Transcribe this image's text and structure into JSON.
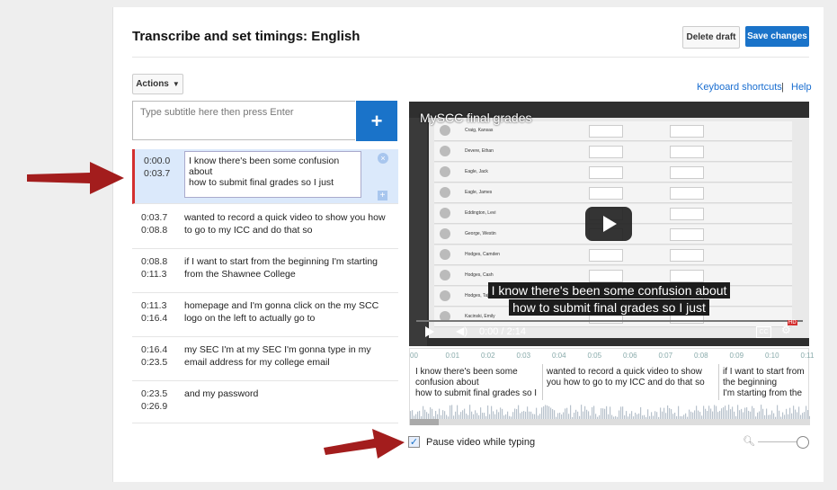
{
  "header": {
    "title": "Transcribe and set timings: English",
    "delete_label": "Delete draft",
    "save_label": "Save changes"
  },
  "toolbar": {
    "actions_label": "Actions",
    "keyboard_shortcuts": "Keyboard shortcuts",
    "separator": "|",
    "help": "Help"
  },
  "subtitle_input": {
    "placeholder": "Type subtitle here then press Enter",
    "add_icon": "plus-icon"
  },
  "captions": [
    {
      "start": "0:00.0",
      "end": "0:03.7",
      "text": "I know there's been some confusion about\nhow to submit final grades so I just",
      "selected": true
    },
    {
      "start": "0:03.7",
      "end": "0:08.8",
      "text": "wanted to record a quick video to show you how to go to my ICC and do that so"
    },
    {
      "start": "0:08.8",
      "end": "0:11.3",
      "text": "if I want to start from the beginning I'm starting from the Shawnee College"
    },
    {
      "start": "0:11.3",
      "end": "0:16.4",
      "text": "homepage and I'm gonna click on the my SCC logo on the left to actually go to"
    },
    {
      "start": "0:16.4",
      "end": "0:23.5",
      "text": "my SEC I'm at my SEC I'm gonna type in my email address for my college email"
    },
    {
      "start": "0:23.5",
      "end": "0:26.9",
      "text": "and my password"
    }
  ],
  "video": {
    "title": "MySCC final grades",
    "caption_line1": "I know there's been some confusion about",
    "caption_line2": "how to submit final grades so I just",
    "time": "0:00 / 2:14",
    "cc": "CC",
    "hd": "HD",
    "sheet_rows": [
      "Craig, Kansas",
      "Devere, Ethan",
      "Eagle, Jack",
      "Eagle, James",
      "Eddington, Levi",
      "George, Westin",
      "Hodges, Camden",
      "Hodges, Cash",
      "Hodges, Taj",
      "Kacinski, Emily"
    ]
  },
  "timeline": {
    "ticks": [
      "00",
      "0:01",
      "0:02",
      "0:03",
      "0:04",
      "0:05",
      "0:06",
      "0:07",
      "0:08",
      "0:09",
      "0:10",
      "0:11"
    ],
    "segments": [
      "I know there's been some confusion about\nhow to submit final grades so I",
      "wanted to record a quick video to show you how to go to my ICC and do that so",
      "if I want to start from the beginning\nI'm starting from the"
    ]
  },
  "options": {
    "pause_label": "Pause video while typing",
    "pause_checked": true
  },
  "colors": {
    "accent": "#1a73c9",
    "selected_row": "#dbe9fb",
    "annotation_arrow": "#a31d1d"
  }
}
